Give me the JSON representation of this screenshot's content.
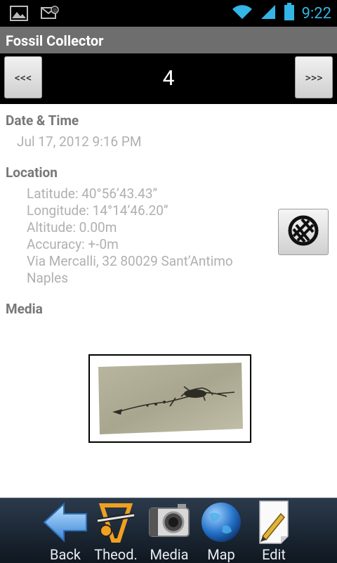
{
  "status_bar": {
    "time": "9:22"
  },
  "app": {
    "title": "Fossil Collector"
  },
  "navigation": {
    "prev_label": "<<<",
    "next_label": ">>>",
    "record_number": "4"
  },
  "date_time": {
    "label": "Date & Time",
    "value": "Jul 17, 2012 9:16 PM"
  },
  "location": {
    "label": "Location",
    "lines": [
      "Latitude: 40°56’43.43’’",
      "Longitude: 14°14’46.20’’",
      "Altitude: 0.00m",
      "Accuracy: +-0m",
      "Via Mercalli, 32 80029 Sant’Antimo",
      "Naples"
    ]
  },
  "media": {
    "label": "Media"
  },
  "bottom_tabs": [
    {
      "label": "Back",
      "icon": "back-arrow-icon"
    },
    {
      "label": "Theod.",
      "icon": "theodolite-icon"
    },
    {
      "label": "Media",
      "icon": "camera-icon"
    },
    {
      "label": "Map",
      "icon": "globe-icon"
    },
    {
      "label": "Edit",
      "icon": "edit-pencil-icon"
    }
  ]
}
